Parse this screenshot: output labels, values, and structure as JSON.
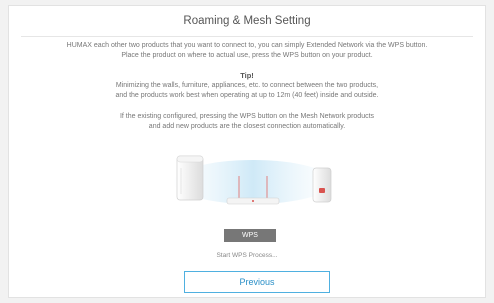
{
  "dialog": {
    "title": "Roaming & Mesh Setting",
    "intro_line1": "HUMAX each other two products that you want to connect to, you can simply Extended Network via the WPS button.",
    "intro_line2": "Place the product on where to actual use, press the WPS button on your product.",
    "tip_heading": "Tip!",
    "tip_line1": "Minimizing the walls, furniture, appliances, etc. to connect between the two products,",
    "tip_line2": "and the products work best when operating at up to 12m (40 feet) inside and outside.",
    "mesh_line1": "If the existing configured, pressing the WPS button on the Mesh Network products",
    "mesh_line2": "and add new products are the closest connection automatically."
  },
  "wps": {
    "button_label": "WPS",
    "status_text": "Start WPS Process..."
  },
  "nav": {
    "previous_label": "Previous"
  },
  "colors": {
    "accent": "#4fb0e0",
    "wps_button": "#777777",
    "signal_glow": "#cfe9f7",
    "led_red": "#d9534f"
  }
}
